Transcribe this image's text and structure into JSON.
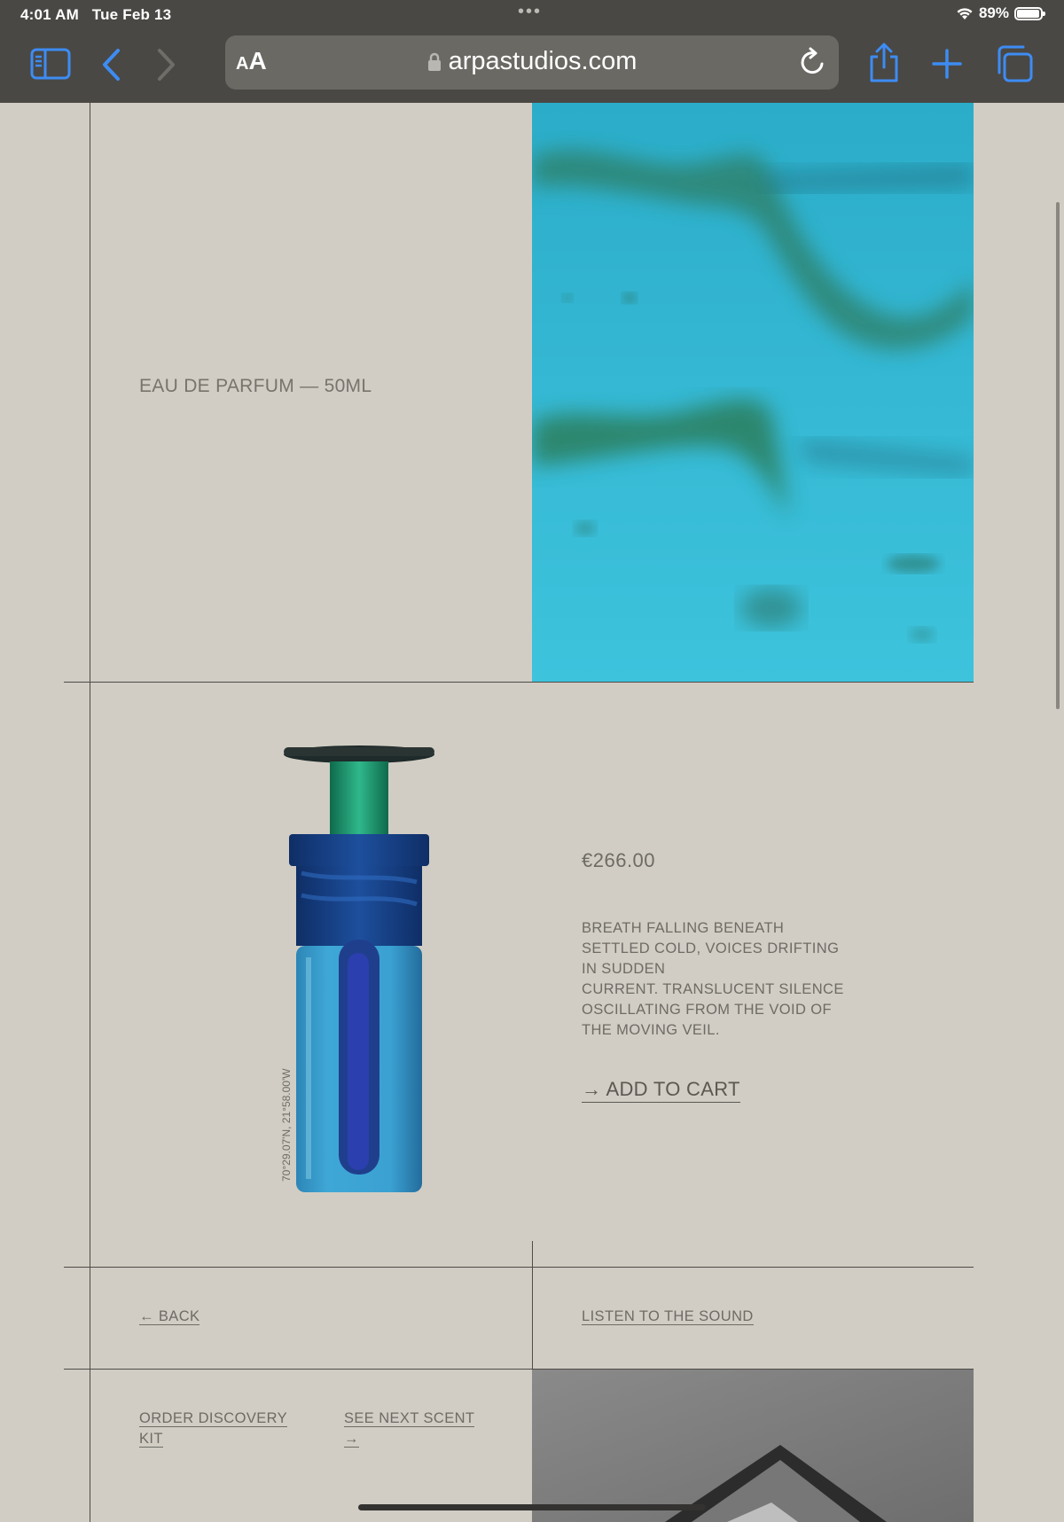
{
  "status_bar": {
    "time": "4:01 AM",
    "date": "Tue Feb 13",
    "battery": "89%"
  },
  "browser": {
    "text_size_label_small": "A",
    "text_size_label_large": "A",
    "url": "arpastudios.com"
  },
  "page": {
    "product_caption": "EAU DE PARFUM — 50ML",
    "coordinates": "70°29.07'N, 21°58.00'W",
    "price": "€266.00",
    "description_lines": [
      "BREATH FALLING BENEATH",
      "SETTLED COLD, VOICES DRIFTING",
      "IN SUDDEN",
      "CURRENT. TRANSLUCENT SILENCE",
      "OSCILLATING FROM THE VOID OF",
      "THE MOVING VEIL."
    ],
    "add_to_cart": "→ ADD TO CART",
    "back": "← BACK",
    "listen": "LISTEN TO THE SOUND",
    "order_kit_line1": "ORDER DISCOVERY",
    "order_kit_line2": "KIT",
    "next_scent_line1": "SEE NEXT SCENT",
    "next_scent_line2": "→"
  },
  "colors": {
    "page_background": "#d1cdc4",
    "chrome_background": "#4a4844",
    "accent_blue": "#3d8cf4",
    "hero_cyan": "#2fb2cf"
  },
  "icons": [
    "sidebar-icon",
    "back-chevron-icon",
    "forward-chevron-icon",
    "lock-icon",
    "reload-icon",
    "share-icon",
    "new-tab-plus-icon",
    "tabs-overview-icon",
    "wifi-icon",
    "battery-icon"
  ]
}
